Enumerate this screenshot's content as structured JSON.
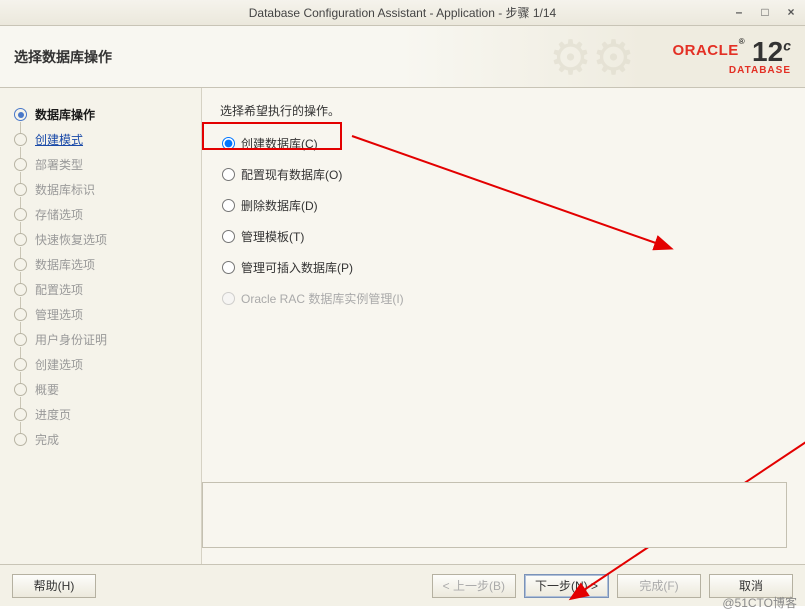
{
  "window": {
    "title": "Database Configuration Assistant - Application - 步骤 1/14"
  },
  "header": {
    "title": "选择数据库操作",
    "brand": "ORACLE",
    "product_line": "DATABASE",
    "version_major": "12",
    "version_suffix": "c"
  },
  "sidebar": {
    "items": [
      {
        "label": "数据库操作",
        "state": "active"
      },
      {
        "label": "创建模式",
        "state": "link"
      },
      {
        "label": "部署类型",
        "state": ""
      },
      {
        "label": "数据库标识",
        "state": ""
      },
      {
        "label": "存储选项",
        "state": ""
      },
      {
        "label": "快速恢复选项",
        "state": ""
      },
      {
        "label": "数据库选项",
        "state": ""
      },
      {
        "label": "配置选项",
        "state": ""
      },
      {
        "label": "管理选项",
        "state": ""
      },
      {
        "label": "用户身份证明",
        "state": ""
      },
      {
        "label": "创建选项",
        "state": ""
      },
      {
        "label": "概要",
        "state": ""
      },
      {
        "label": "进度页",
        "state": ""
      },
      {
        "label": "完成",
        "state": ""
      }
    ]
  },
  "main": {
    "instruction": "选择希望执行的操作。",
    "options": [
      {
        "label": "创建数据库(C)",
        "checked": true,
        "disabled": false
      },
      {
        "label": "配置现有数据库(O)",
        "checked": false,
        "disabled": false
      },
      {
        "label": "删除数据库(D)",
        "checked": false,
        "disabled": false
      },
      {
        "label": "管理模板(T)",
        "checked": false,
        "disabled": false
      },
      {
        "label": "管理可插入数据库(P)",
        "checked": false,
        "disabled": false
      },
      {
        "label": "Oracle RAC 数据库实例管理(I)",
        "checked": false,
        "disabled": true
      }
    ]
  },
  "footer": {
    "help": "帮助(H)",
    "back": "< 上一步(B)",
    "next": "下一步(N) >",
    "finish": "完成(F)",
    "cancel": "取消"
  },
  "watermark": "@51CTO博客"
}
